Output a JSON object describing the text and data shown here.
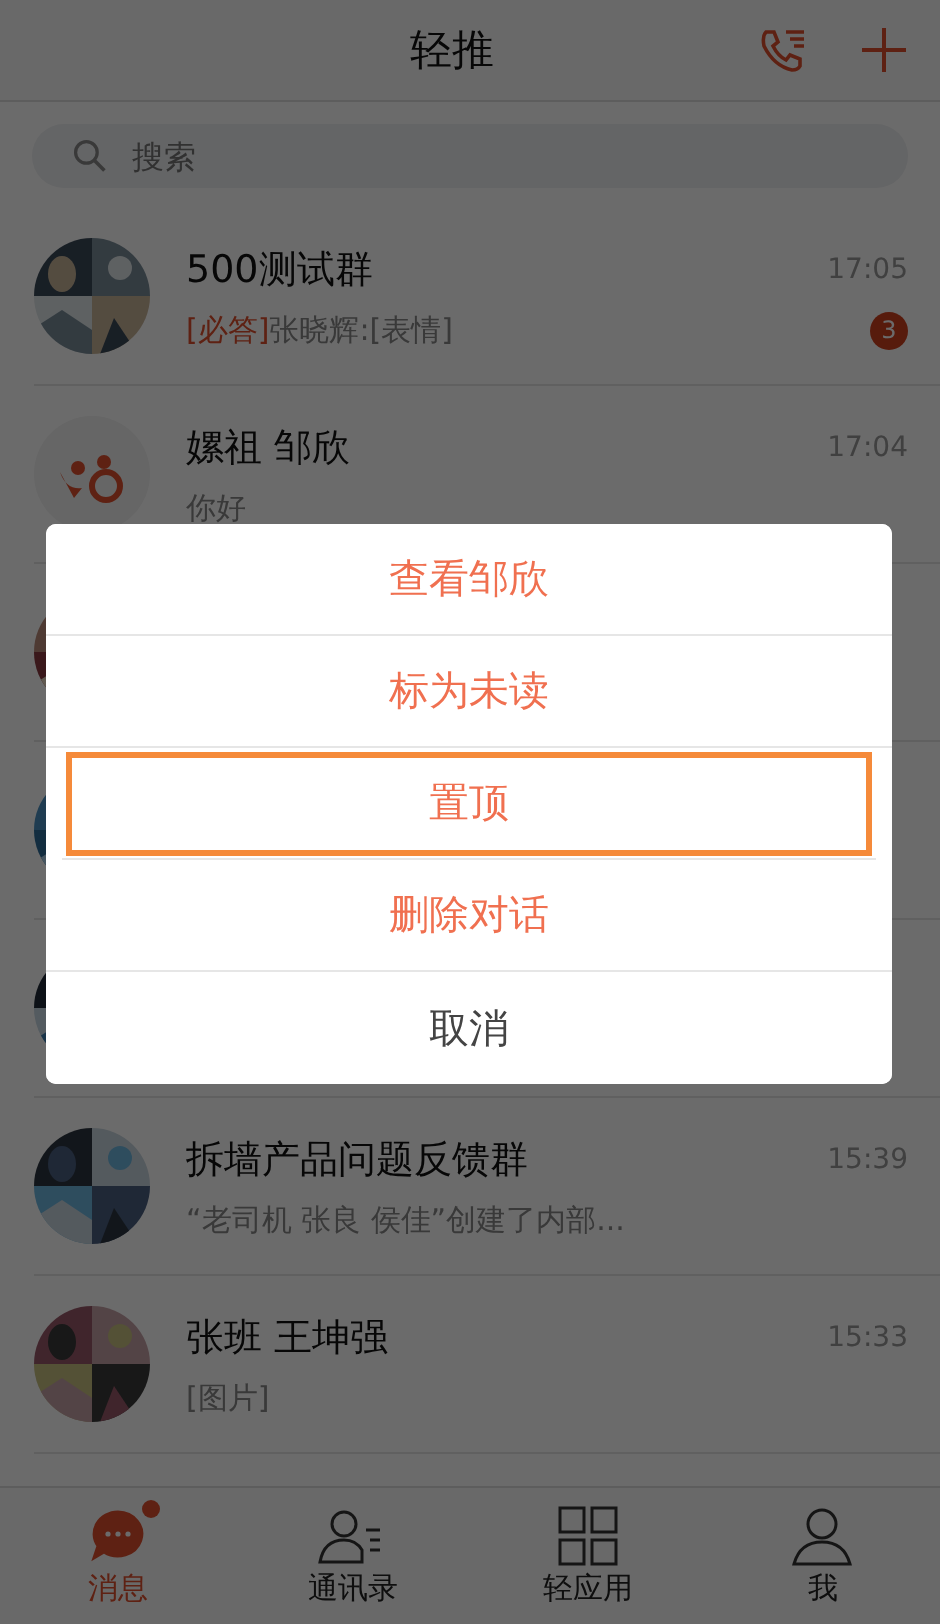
{
  "header": {
    "title": "轻推"
  },
  "search": {
    "placeholder": "搜索"
  },
  "conversations": [
    {
      "kind": "picture",
      "name": "500测试群",
      "time": "17:05",
      "tag": "[必答]",
      "preview": "张晓辉:[表情]",
      "unread": "3"
    },
    {
      "kind": "logo",
      "name": "嫘祖 邹欣",
      "time": "17:04",
      "preview": "你好"
    },
    {
      "kind": "picture"
    },
    {
      "kind": "picture"
    },
    {
      "kind": "picture"
    },
    {
      "kind": "picture",
      "name": "拆墙产品问题反馈群",
      "time": "15:39",
      "preview": "“老司机 张良 侯佳”创建了内部..."
    },
    {
      "kind": "picture",
      "name": "张班  王坤强",
      "time": "15:33",
      "preview": "[图片]"
    }
  ],
  "menu": [
    {
      "label": "查看邹欣",
      "kind": "action",
      "selected": false
    },
    {
      "label": "标为未读",
      "kind": "action",
      "selected": false
    },
    {
      "label": "置顶",
      "kind": "action",
      "selected": true
    },
    {
      "label": "删除对话",
      "kind": "action",
      "selected": false
    },
    {
      "label": "取消",
      "kind": "cancel",
      "selected": false
    }
  ],
  "tabs": [
    {
      "label": "消息",
      "selected": true,
      "dot": true
    },
    {
      "label": "通讯录",
      "selected": false,
      "dot": false
    },
    {
      "label": "轻应用",
      "selected": false,
      "dot": false
    },
    {
      "label": "我",
      "selected": false,
      "dot": false
    }
  ]
}
